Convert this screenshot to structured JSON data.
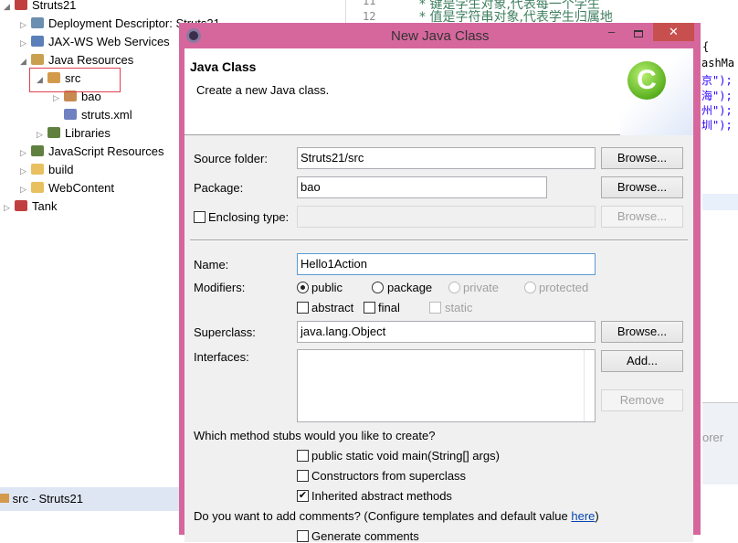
{
  "tree": [
    {
      "label": "Struts21",
      "arrow": "◢",
      "color": "#c04040"
    },
    {
      "label": "Deployment Descriptor: Struts21",
      "arrow": "▷",
      "color": "#6a8fb0"
    },
    {
      "label": "JAX-WS Web Services",
      "arrow": "▷",
      "color": "#5b7fb8"
    },
    {
      "label": "Java Resources",
      "arrow": "◢",
      "color": "#c8a050"
    },
    {
      "label": "src",
      "arrow": "◢",
      "color": "#d49a4c"
    },
    {
      "label": "bao",
      "arrow": "▷",
      "color": "#c88a50"
    },
    {
      "label": "struts.xml",
      "arrow": "",
      "color": "#7080c0"
    },
    {
      "label": "Libraries",
      "arrow": "▷",
      "color": "#608040"
    },
    {
      "label": "JavaScript Resources",
      "arrow": "▷",
      "color": "#608040"
    },
    {
      "label": "build",
      "arrow": "▷",
      "color": "#e8c060"
    },
    {
      "label": "WebContent",
      "arrow": "▷",
      "color": "#e8c060"
    },
    {
      "label": "Tank",
      "arrow": "▷",
      "color": "#c04040"
    }
  ],
  "status_tab": "src - Struts21",
  "editor": {
    "lines": [
      {
        "num": "11",
        "text": "* 键是学生对象,代表每一个学生"
      },
      {
        "num": "12",
        "text": "* 值是字符串对象,代表学生归属地"
      }
    ],
    "fragments": [
      "{",
      "ashMa",
      "京\");",
      "海\");",
      "州\");",
      "圳\");"
    ],
    "side_text": "orer"
  },
  "dialog": {
    "title": "New Java Class",
    "header_title": "Java Class",
    "header_desc": "Create a new Java class.",
    "source_folder_label": "Source folder:",
    "source_folder": "Struts21/src",
    "package_label": "Package:",
    "package": "bao",
    "enclosing_label": "Enclosing type:",
    "browse": "Browse...",
    "name_label": "Name:",
    "name": "Hello1Action",
    "modifiers_label": "Modifiers:",
    "modifiers": {
      "public": "public",
      "package": "package",
      "private": "private",
      "protected": "protected",
      "abstract": "abstract",
      "final": "final",
      "static": "static",
      "selected": "public"
    },
    "superclass_label": "Superclass:",
    "superclass": "java.lang.Object",
    "interfaces_label": "Interfaces:",
    "add": "Add...",
    "remove": "Remove",
    "stubs_question": "Which method stubs would you like to create?",
    "stubs": [
      {
        "label": "public static void main(String[] args)",
        "checked": false
      },
      {
        "label": "Constructors from superclass",
        "checked": false
      },
      {
        "label": "Inherited abstract methods",
        "checked": true
      }
    ],
    "comments_question": "Do you want to add comments? (Configure templates and default value ",
    "comments_link": "here",
    "comments_close": ")",
    "generate_comments": "Generate comments"
  }
}
